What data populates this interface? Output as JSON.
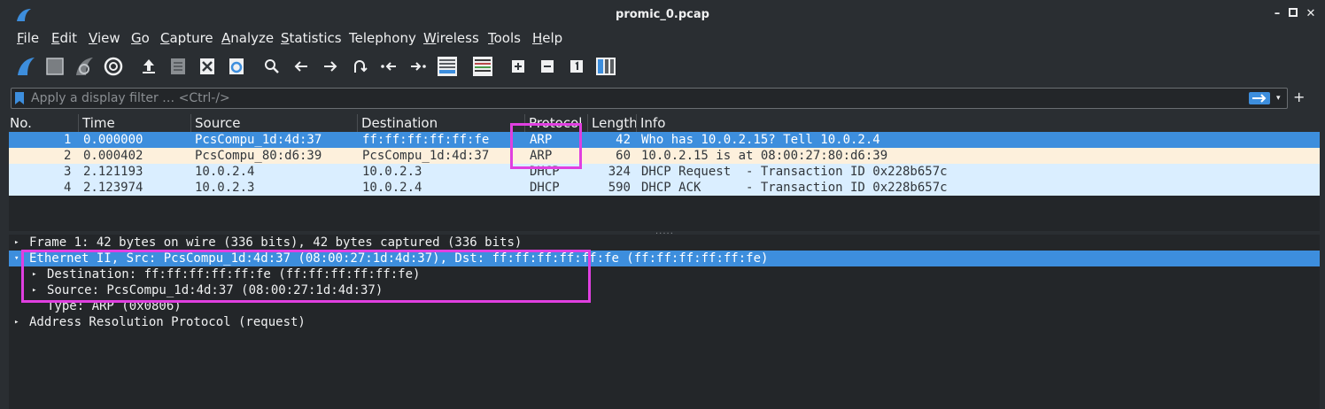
{
  "window": {
    "title": "promic_0.pcap",
    "app_icon": "wireshark-fin-icon",
    "controls": [
      "minimize-icon",
      "maximize-icon",
      "close-icon"
    ]
  },
  "menu": [
    {
      "label": "File",
      "mnemonic": "F",
      "rest": "ile"
    },
    {
      "label": "Edit",
      "mnemonic": "E",
      "rest": "dit"
    },
    {
      "label": "View",
      "mnemonic": "V",
      "rest": "iew"
    },
    {
      "label": "Go",
      "mnemonic": "G",
      "rest": "o"
    },
    {
      "label": "Capture",
      "mnemonic": "C",
      "rest": "apture"
    },
    {
      "label": "Analyze",
      "mnemonic": "A",
      "rest": "nalyze"
    },
    {
      "label": "Statistics",
      "mnemonic": "S",
      "rest": "tatistics"
    },
    {
      "label": "Telephony",
      "mnemonic": "",
      "rest": "Telephony"
    },
    {
      "label": "Wireless",
      "mnemonic": "W",
      "rest": "ireless"
    },
    {
      "label": "Tools",
      "mnemonic": "T",
      "rest": "ools"
    },
    {
      "label": "Help",
      "mnemonic": "H",
      "rest": "elp"
    }
  ],
  "toolbar_icons": [
    "start-capture-icon",
    "stop-capture-icon",
    "restart-capture-icon",
    "capture-options-icon",
    "open-file-icon",
    "save-file-icon",
    "close-file-icon",
    "reload-file-icon",
    "find-packet-icon",
    "go-back-icon",
    "go-forward-icon",
    "go-to-packet-icon",
    "go-first-packet-icon",
    "go-last-packet-icon",
    "auto-scroll-icon",
    "colorize-icon",
    "zoom-in-icon",
    "zoom-out-icon",
    "normal-size-icon",
    "resize-columns-icon"
  ],
  "filter": {
    "placeholder": "Apply a display filter … <Ctrl-/>",
    "value": ""
  },
  "packet_list": {
    "columns": [
      "No.",
      "Time",
      "Source",
      "Destination",
      "Protocol",
      "Length",
      "Info"
    ],
    "rows": [
      {
        "no": "1",
        "time": "0.000000",
        "source": "PcsCompu_1d:4d:37",
        "destination": "ff:ff:ff:ff:ff:fe",
        "protocol": "ARP",
        "length": "42",
        "info": "Who has 10.0.2.15? Tell 10.0.2.4"
      },
      {
        "no": "2",
        "time": "0.000402",
        "source": "PcsCompu_80:d6:39",
        "destination": "PcsCompu_1d:4d:37",
        "protocol": "ARP",
        "length": "60",
        "info": "10.0.2.15 is at 08:00:27:80:d6:39"
      },
      {
        "no": "3",
        "time": "2.121193",
        "source": "10.0.2.4",
        "destination": "10.0.2.3",
        "protocol": "DHCP",
        "length": "324",
        "info": "DHCP Request  - Transaction ID 0x228b657c"
      },
      {
        "no": "4",
        "time": "2.123974",
        "source": "10.0.2.3",
        "destination": "10.0.2.4",
        "protocol": "DHCP",
        "length": "590",
        "info": "DHCP ACK      - Transaction ID 0x228b657c"
      }
    ]
  },
  "details": [
    {
      "text": "Frame 1: 42 bytes on wire (336 bits), 42 bytes captured (336 bits)",
      "arrow": "▸"
    },
    {
      "text": "Ethernet II, Src: PcsCompu_1d:4d:37 (08:00:27:1d:4d:37), Dst: ff:ff:ff:ff:ff:fe (ff:ff:ff:ff:ff:fe)",
      "arrow": "▾"
    },
    {
      "text": "Destination: ff:ff:ff:ff:ff:fe (ff:ff:ff:ff:ff:fe)",
      "arrow": "▸"
    },
    {
      "text": "Source: PcsCompu_1d:4d:37 (08:00:27:1d:4d:37)",
      "arrow": "▸"
    },
    {
      "text": "Type: ARP (0x0806)",
      "arrow": ""
    },
    {
      "text": "Address Resolution Protocol (request)",
      "arrow": "▸"
    }
  ],
  "colors": {
    "selected_row": "#3d8edd",
    "arp_row": "#fdf0dc",
    "dhcp_row": "#daeeff",
    "highlight_box": "#e03fe0"
  }
}
